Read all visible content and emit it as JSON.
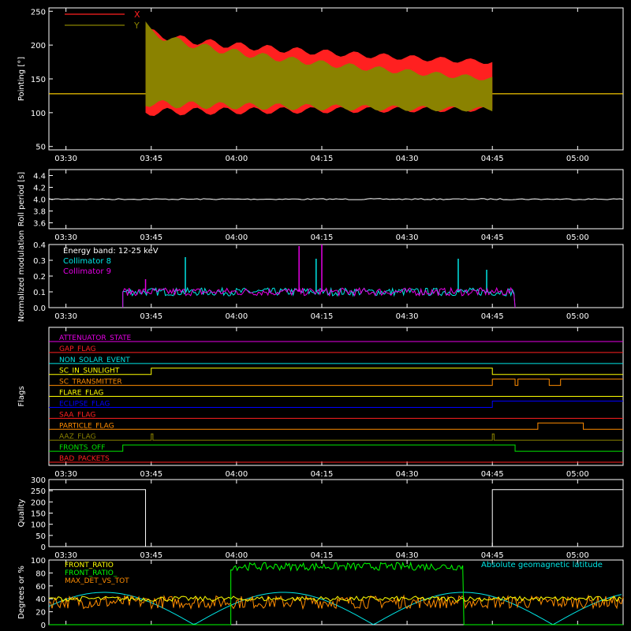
{
  "chart_data": [
    {
      "type": "line",
      "ylabel": "Pointing [°]",
      "yticks": [
        "50",
        "100",
        "150",
        "200",
        "250"
      ],
      "ylim": [
        45,
        255
      ],
      "xticks": [
        "03:30",
        "03:45",
        "04:00",
        "04:15",
        "04:30",
        "04:45",
        "05:00"
      ],
      "xlim": [
        "03:27",
        "05:08"
      ],
      "legend": [
        {
          "name": "X",
          "color": "#ff2020"
        },
        {
          "name": "Y",
          "color": "#8a8200"
        }
      ],
      "series": [
        {
          "name": "X",
          "color": "#ff2020",
          "baseline": 128,
          "oscillation_start": "03:44",
          "oscillation_end": "04:45",
          "envelope_start": [
            100,
            225
          ],
          "envelope_end": [
            105,
            175
          ]
        },
        {
          "name": "Y",
          "color": "#8a8200",
          "baseline": 128,
          "oscillation_start": "03:44",
          "oscillation_end": "04:45",
          "envelope_start": [
            115,
            230
          ],
          "envelope_end": [
            105,
            150
          ]
        }
      ]
    },
    {
      "type": "line",
      "ylabel": "Roll period [s]",
      "yticks": [
        "3.6",
        "3.8",
        "4.0",
        "4.2",
        "4.4"
      ],
      "ylim": [
        3.5,
        4.5
      ],
      "xticks": [
        "03:30",
        "03:45",
        "04:00",
        "04:15",
        "04:30",
        "04:45",
        "05:00"
      ],
      "series": [
        {
          "name": "Roll period",
          "color": "#ffffff",
          "value": 4.0
        }
      ]
    },
    {
      "type": "line",
      "ylabel": "Normalized modulation",
      "yticks": [
        "0.0",
        "0.1",
        "0.2",
        "0.3",
        "0.4"
      ],
      "ylim": [
        0,
        0.4
      ],
      "xticks": [
        "03:30",
        "03:45",
        "04:00",
        "04:15",
        "04:30",
        "04:45",
        "05:00"
      ],
      "annotations": [
        "Energy band: 12-25 keV"
      ],
      "legend": [
        {
          "name": "Collimator 8",
          "color": "#00e6e6"
        },
        {
          "name": "Collimator 9",
          "color": "#e600e6"
        }
      ],
      "series": [
        {
          "name": "Collimator 8",
          "color": "#00e6e6",
          "level": 0.1,
          "start": "03:40",
          "end": "04:49",
          "spikes": [
            [
              "03:51",
              0.32
            ],
            [
              "04:14",
              0.31
            ],
            [
              "04:39",
              0.31
            ],
            [
              "04:44",
              0.24
            ]
          ]
        },
        {
          "name": "Collimator 9",
          "color": "#e600e6",
          "level": 0.1,
          "start": "03:40",
          "end": "04:49",
          "spikes": [
            [
              "04:11",
              0.39
            ],
            [
              "04:15",
              0.4
            ],
            [
              "03:44",
              0.18
            ]
          ]
        }
      ]
    },
    {
      "type": "line",
      "ylabel": "Flags",
      "xticks": [
        "03:30",
        "03:45",
        "04:00",
        "04:15",
        "04:30",
        "04:45",
        "05:00"
      ],
      "flags": [
        {
          "name": "ATTENUATOR_STATE",
          "color": "#e600e6",
          "steps": []
        },
        {
          "name": "GAP_FLAG",
          "color": "#ff2020",
          "steps": []
        },
        {
          "name": "NON_SOLAR_EVENT",
          "color": "#00e6e6",
          "steps": []
        },
        {
          "name": "SC_IN_SUNLIGHT",
          "color": "#ffff00",
          "steps": [
            [
              "03:45",
              1
            ],
            [
              "04:45",
              0
            ]
          ]
        },
        {
          "name": "SC_TRANSMITTER",
          "color": "#ff8c00",
          "steps": [
            [
              "04:45",
              1
            ],
            [
              "04:49",
              0
            ],
            [
              "04:49.5",
              1
            ],
            [
              "04:55",
              0
            ],
            [
              "04:57",
              1
            ]
          ]
        },
        {
          "name": "FLARE_FLAG",
          "color": "#ffff00",
          "steps": []
        },
        {
          "name": "ECLIPSE_FLAG",
          "color": "#0000ff",
          "steps": [
            [
              "03:45",
              0
            ],
            [
              "04:45",
              1
            ]
          ]
        },
        {
          "name": "SAA_FLAG",
          "color": "#ff2020",
          "steps": []
        },
        {
          "name": "PARTICLE_FLAG",
          "color": "#ff8c00",
          "steps": [
            [
              "04:53",
              1
            ],
            [
              "05:01",
              0
            ]
          ]
        },
        {
          "name": "AAZ_FLAG",
          "color": "#8a8200",
          "steps": [
            [
              "03:45",
              1
            ],
            [
              "03:45.3",
              0
            ],
            [
              "04:45",
              1
            ],
            [
              "04:45.3",
              0
            ]
          ]
        },
        {
          "name": "FRONTS_OFF",
          "color": "#00e600",
          "steps": [
            [
              "03:40",
              1
            ],
            [
              "04:49",
              0
            ]
          ]
        },
        {
          "name": "BAD_PACKETS",
          "color": "#ff2020",
          "steps": []
        }
      ]
    },
    {
      "type": "line",
      "ylabel": "Quality",
      "yticks": [
        "0",
        "50",
        "100",
        "150",
        "200",
        "250",
        "300"
      ],
      "ylim": [
        0,
        300
      ],
      "xticks": [
        "03:30",
        "03:45",
        "04:00",
        "04:15",
        "04:30",
        "04:45",
        "05:00"
      ],
      "series": [
        {
          "name": "Quality",
          "color": "#ffffff",
          "segments": [
            [
              "03:27",
              "03:44",
              255
            ],
            [
              "03:44",
              "04:45",
              0
            ],
            [
              "04:45",
              "05:08",
              255
            ]
          ]
        }
      ]
    },
    {
      "type": "line",
      "ylabel": "Degrees or %",
      "yticks": [
        "0",
        "20",
        "40",
        "60",
        "80",
        "100"
      ],
      "ylim": [
        0,
        100
      ],
      "xticks": [
        "03:30",
        "03:45",
        "04:00",
        "04:15",
        "04:30",
        "04:45",
        "05:00"
      ],
      "legend": [
        {
          "name": "FRONT_RATIO",
          "color": "#ffff00"
        },
        {
          "name": "FRONT_RATIO_",
          "color": "#00ff00"
        },
        {
          "name": "MAX_DET_VS_TOT",
          "color": "#ff8c00"
        },
        {
          "name": "Absolute geomagnetic latitude",
          "color": "#00e6e6"
        }
      ],
      "series": [
        {
          "name": "FRONT_RATIO",
          "color": "#ffff00",
          "level": 40
        },
        {
          "name": "FRONT_RATIO_",
          "color": "#00ff00",
          "level": 90
        },
        {
          "name": "MAX_DET_VS_TOT",
          "color": "#ff8c00",
          "level": 35
        },
        {
          "name": "Absolute geomagnetic latitude",
          "color": "#00e6e6",
          "range": [
            0,
            50
          ]
        }
      ]
    }
  ]
}
